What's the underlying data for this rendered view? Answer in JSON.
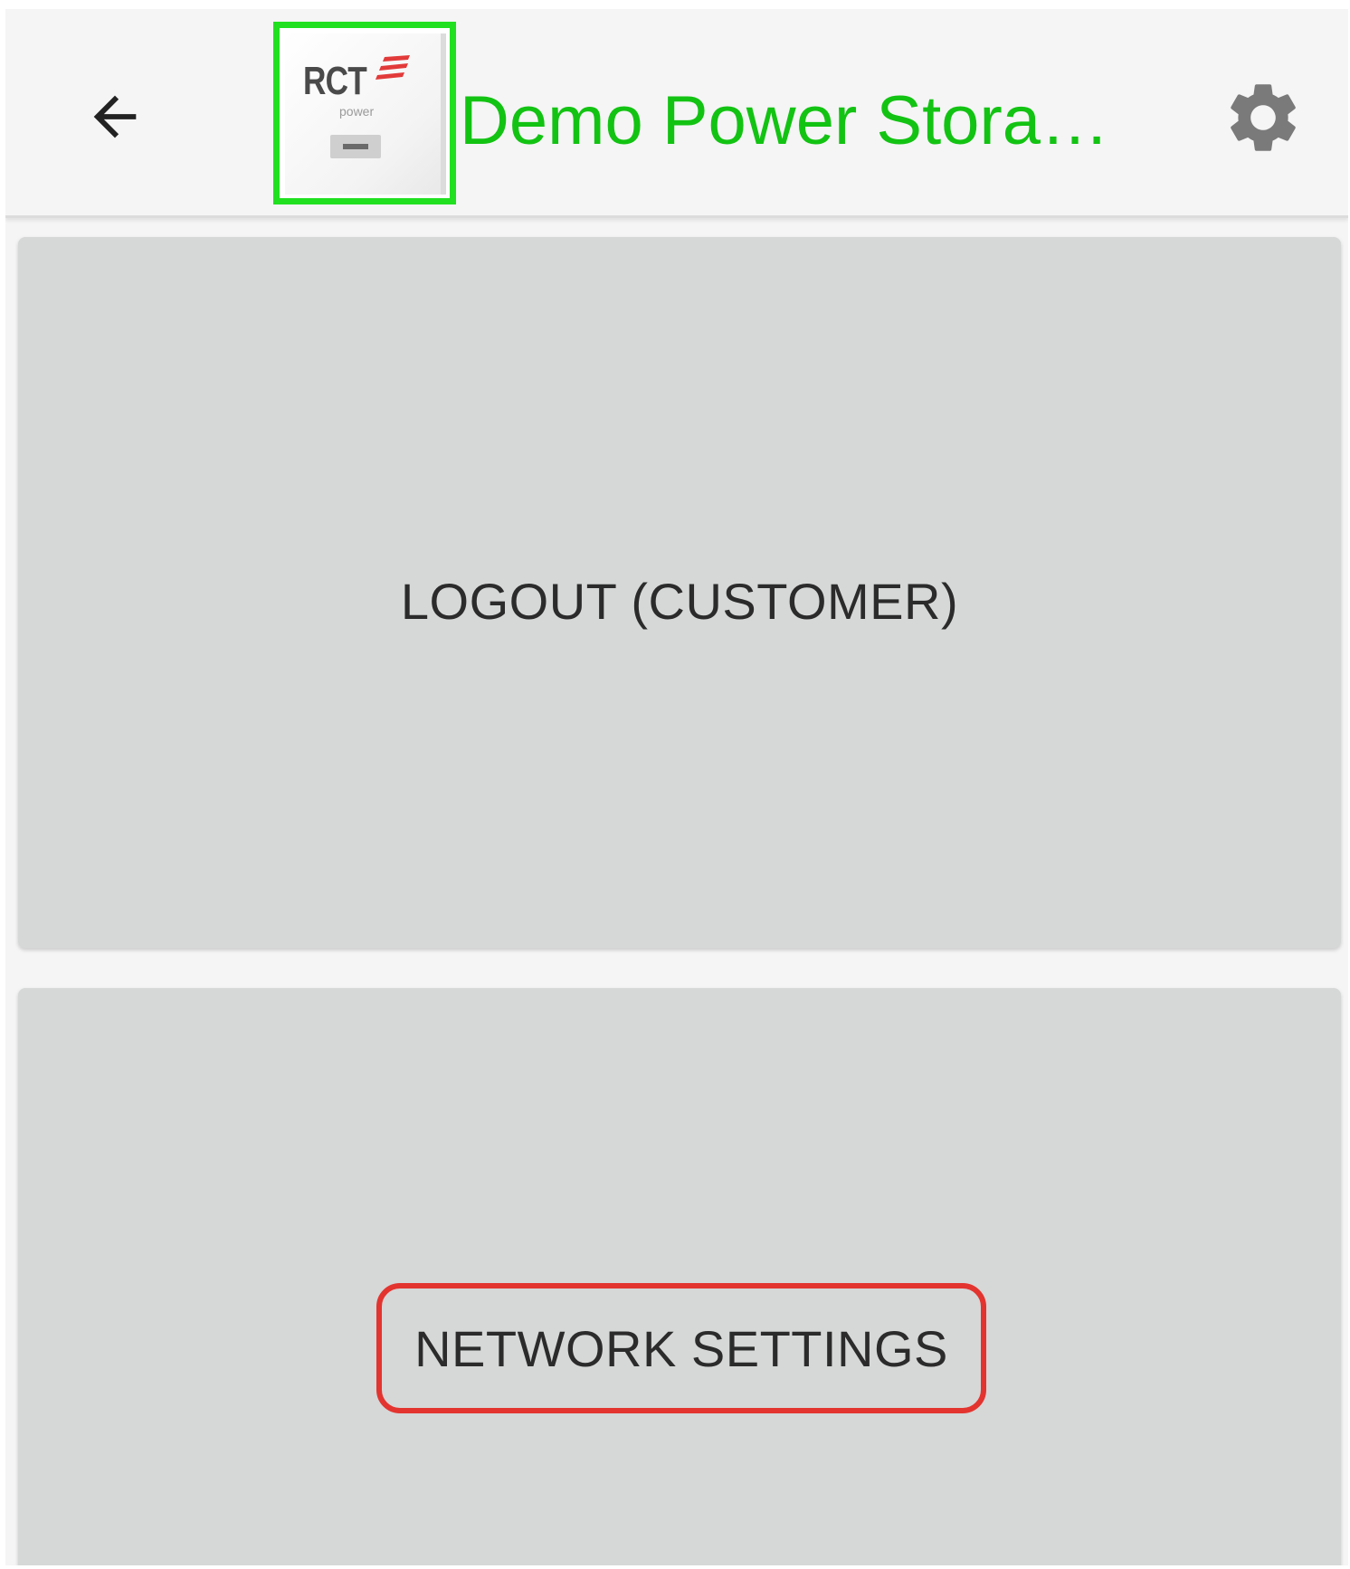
{
  "app_bar": {
    "title": "Demo Power Stora…",
    "logo": {
      "brand_text": "RCT",
      "sub_text": "power",
      "highlight_color": "#20e020"
    },
    "back_icon": "arrow-left-icon",
    "settings_icon": "gear-icon",
    "title_color": "#13c313"
  },
  "menu": {
    "items": [
      {
        "label": "LOGOUT (CUSTOMER)"
      },
      {
        "label": "NETWORK SETTINGS"
      }
    ],
    "card_color": "#d6d7d7",
    "highlight_color": "#e3342f"
  }
}
